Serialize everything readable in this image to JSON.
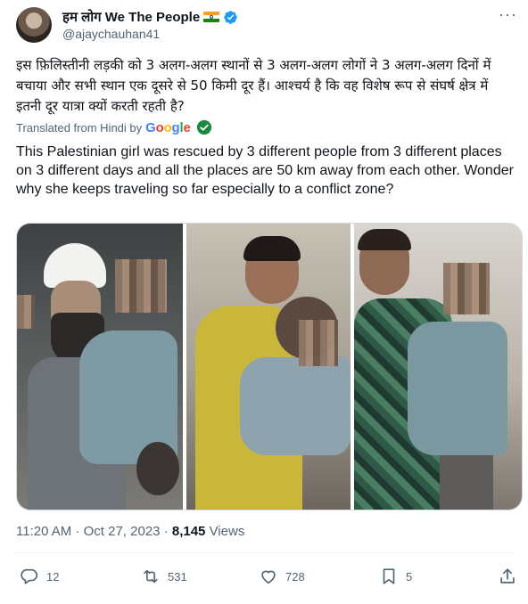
{
  "author": {
    "display_name": "हम लोग We The People",
    "handle": "@ajaychauhan41"
  },
  "tweet": {
    "hindi_text": "इस फ़िलिस्तीनी लड़की को 3 अलग-अलग स्थानों से 3 अलग-अलग लोगों ने 3 अलग-अलग दिनों में बचाया और सभी स्थान एक दूसरे से 50 किमी दूर हैं। आश्चर्य है कि वह विशेष रूप से संघर्ष क्षेत्र में इतनी दूर यात्रा क्यों करती रहती है?",
    "translated_label": "Translated from Hindi by",
    "translator": "Google",
    "english_text": "This Palestinian girl was rescued by 3 different people from 3 different places on 3 different days and all the places are 50 km away from each other. Wonder why she keeps traveling so far especially to a conflict zone?"
  },
  "meta": {
    "time": "11:20 AM",
    "separator": "·",
    "date": "Oct 27, 2023",
    "views_count": "8,145",
    "views_label": "Views"
  },
  "actions": {
    "replies": "12",
    "retweets": "531",
    "likes": "728",
    "bookmarks": "5"
  },
  "colors": {
    "verified_blue": "#1d9bf0",
    "muted": "#536471",
    "accent_green": "#1a8a3f"
  }
}
